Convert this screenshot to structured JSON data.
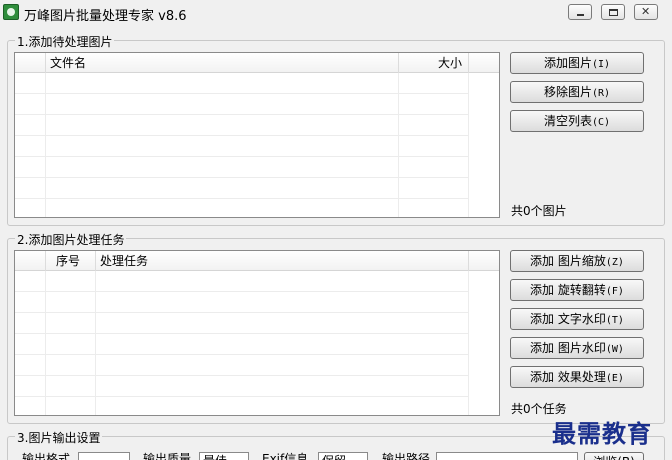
{
  "window": {
    "title": "万峰图片批量处理专家 v8.6",
    "close_glyph": "✕"
  },
  "section1": {
    "title": "1.添加待处理图片",
    "columns": [
      "文件名",
      "大小"
    ],
    "buttons": {
      "add": "添加图片",
      "add_shortcut": "(I)",
      "remove": "移除图片",
      "remove_shortcut": "(R)",
      "clear": "清空列表",
      "clear_shortcut": "(C)"
    },
    "count_label": "共0个图片"
  },
  "section2": {
    "title": "2.添加图片处理任务",
    "columns": [
      "序号",
      "处理任务"
    ],
    "buttons": [
      {
        "label": "添加 图片缩放",
        "shortcut": "(Z)"
      },
      {
        "label": "添加 旋转翻转",
        "shortcut": "(F)"
      },
      {
        "label": "添加 文字水印",
        "shortcut": "(T)"
      },
      {
        "label": "添加 图片水印",
        "shortcut": "(W)"
      },
      {
        "label": "添加 效果处理",
        "shortcut": "(E)"
      }
    ],
    "count_label": "共0个任务"
  },
  "section3": {
    "title": "3.图片输出设置",
    "format_label": "输出格式",
    "quality_label": "输出质量",
    "quality_value": "最佳",
    "exif_label": "Exif信息",
    "exif_value": "保留",
    "path_label": "输出路径",
    "browse_label": "浏览(B)"
  },
  "watermark": "最需教育"
}
